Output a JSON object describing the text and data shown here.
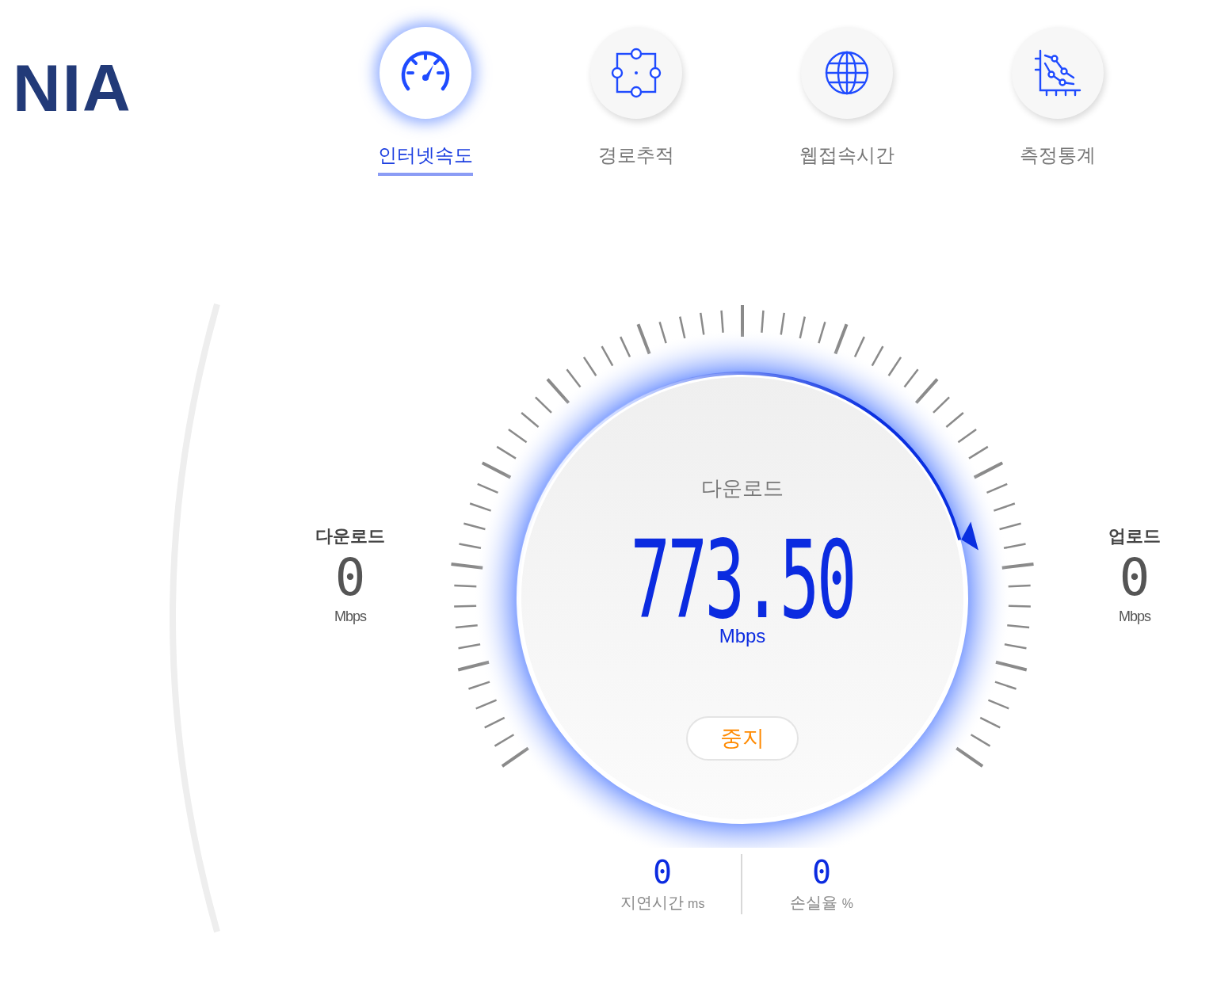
{
  "logo": "NIA",
  "tabs": [
    {
      "label": "인터넷속도",
      "selected": true
    },
    {
      "label": "경로추적",
      "selected": false
    },
    {
      "label": "웹접속시간",
      "selected": false
    },
    {
      "label": "측정통계",
      "selected": false
    }
  ],
  "gauge": {
    "label": "다운로드",
    "value": "773.50",
    "unit": "Mbps",
    "level": 0.8,
    "stop_button": "중지"
  },
  "side_stats": [
    {
      "label": "다운로드",
      "value": "0",
      "unit": "Mbps"
    },
    {
      "label": "업로드",
      "value": "0",
      "unit": "Mbps"
    }
  ],
  "bottom_stats": [
    {
      "value": "0",
      "label": "지연시간",
      "unit": "ms"
    },
    {
      "value": "0",
      "label": "손실율",
      "unit": "%"
    }
  ]
}
